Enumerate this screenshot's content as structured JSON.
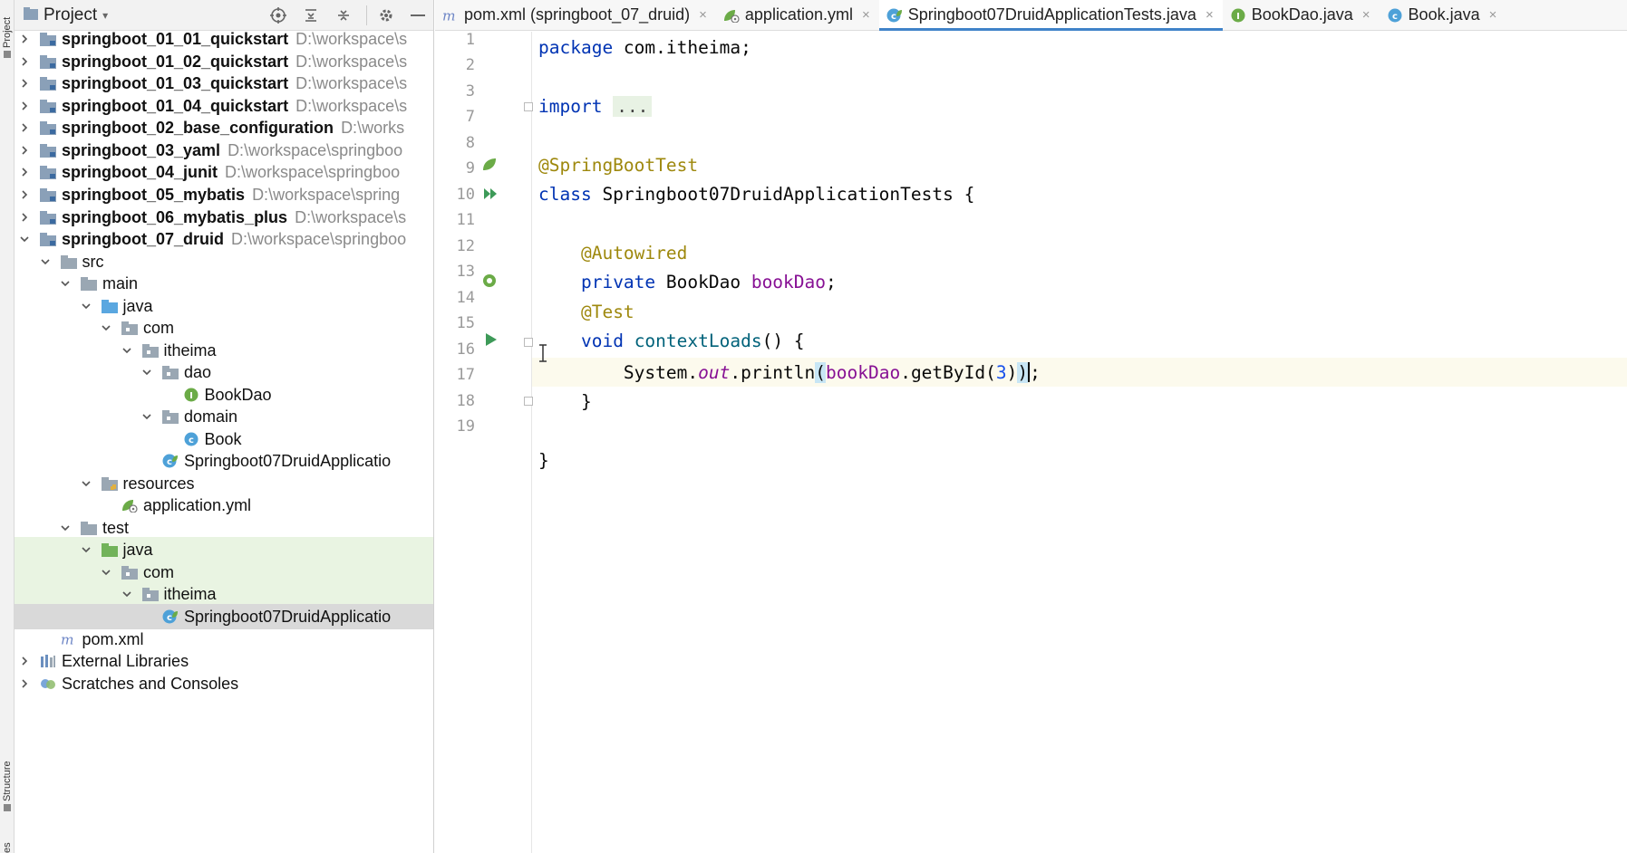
{
  "toolstrip": {
    "project_label": "Project",
    "structure_label": "Structure",
    "bottom_label": "es"
  },
  "project_panel": {
    "title": "Project",
    "header_icons": [
      "target-icon",
      "expand-all-icon",
      "collapse-all-icon",
      "gear-icon",
      "minimize-icon"
    ],
    "rows": [
      {
        "label": "springboot_01_01_quickstart",
        "path": "D:\\workspace\\s",
        "bold": true,
        "indent": 0,
        "chevron": "right",
        "icon": "module-folder-icon"
      },
      {
        "label": "springboot_01_02_quickstart",
        "path": "D:\\workspace\\s",
        "bold": true,
        "indent": 0,
        "chevron": "right",
        "icon": "module-folder-icon"
      },
      {
        "label": "springboot_01_03_quickstart",
        "path": "D:\\workspace\\s",
        "bold": true,
        "indent": 0,
        "chevron": "right",
        "icon": "module-folder-icon"
      },
      {
        "label": "springboot_01_04_quickstart",
        "path": "D:\\workspace\\s",
        "bold": true,
        "indent": 0,
        "chevron": "right",
        "icon": "module-folder-icon"
      },
      {
        "label": "springboot_02_base_configuration",
        "path": "D:\\works",
        "bold": true,
        "indent": 0,
        "chevron": "right",
        "icon": "module-folder-icon"
      },
      {
        "label": "springboot_03_yaml",
        "path": "D:\\workspace\\springboo",
        "bold": true,
        "indent": 0,
        "chevron": "right",
        "icon": "module-folder-icon"
      },
      {
        "label": "springboot_04_junit",
        "path": "D:\\workspace\\springboo",
        "bold": true,
        "indent": 0,
        "chevron": "right",
        "icon": "module-folder-icon"
      },
      {
        "label": "springboot_05_mybatis",
        "path": "D:\\workspace\\spring",
        "bold": true,
        "indent": 0,
        "chevron": "right",
        "icon": "module-folder-icon"
      },
      {
        "label": "springboot_06_mybatis_plus",
        "path": "D:\\workspace\\s",
        "bold": true,
        "indent": 0,
        "chevron": "right",
        "icon": "module-folder-icon"
      },
      {
        "label": "springboot_07_druid",
        "path": "D:\\workspace\\springboo",
        "bold": true,
        "indent": 0,
        "chevron": "down",
        "icon": "module-folder-icon"
      },
      {
        "label": "src",
        "path": "",
        "bold": false,
        "indent": 1,
        "chevron": "down",
        "icon": "folder-icon"
      },
      {
        "label": "main",
        "path": "",
        "bold": false,
        "indent": 2,
        "chevron": "down",
        "icon": "folder-icon"
      },
      {
        "label": "java",
        "path": "",
        "bold": false,
        "indent": 3,
        "chevron": "down",
        "icon": "source-folder-icon"
      },
      {
        "label": "com",
        "path": "",
        "bold": false,
        "indent": 4,
        "chevron": "down",
        "icon": "package-icon"
      },
      {
        "label": "itheima",
        "path": "",
        "bold": false,
        "indent": 5,
        "chevron": "down",
        "icon": "package-icon"
      },
      {
        "label": "dao",
        "path": "",
        "bold": false,
        "indent": 6,
        "chevron": "down",
        "icon": "package-icon"
      },
      {
        "label": "BookDao",
        "path": "",
        "bold": false,
        "indent": 7,
        "chevron": "none",
        "icon": "interface-icon"
      },
      {
        "label": "domain",
        "path": "",
        "bold": false,
        "indent": 6,
        "chevron": "down",
        "icon": "package-icon"
      },
      {
        "label": "Book",
        "path": "",
        "bold": false,
        "indent": 7,
        "chevron": "none",
        "icon": "class-icon"
      },
      {
        "label": "Springboot07DruidApplicatio",
        "path": "",
        "bold": false,
        "indent": 6,
        "chevron": "none",
        "icon": "spring-class-icon"
      },
      {
        "label": "resources",
        "path": "",
        "bold": false,
        "indent": 3,
        "chevron": "down",
        "icon": "resources-folder-icon"
      },
      {
        "label": "application.yml",
        "path": "",
        "bold": false,
        "indent": 4,
        "chevron": "none",
        "icon": "yml-file-icon"
      },
      {
        "label": "test",
        "path": "",
        "bold": false,
        "indent": 2,
        "chevron": "down",
        "icon": "folder-icon"
      },
      {
        "label": "java",
        "path": "",
        "bold": false,
        "indent": 3,
        "chevron": "down",
        "icon": "test-folder-icon",
        "highlight": "green"
      },
      {
        "label": "com",
        "path": "",
        "bold": false,
        "indent": 4,
        "chevron": "down",
        "icon": "package-icon",
        "highlight": "green"
      },
      {
        "label": "itheima",
        "path": "",
        "bold": false,
        "indent": 5,
        "chevron": "down",
        "icon": "package-icon",
        "highlight": "green"
      },
      {
        "label": "Springboot07DruidApplicatio",
        "path": "",
        "bold": false,
        "indent": 6,
        "chevron": "none",
        "icon": "spring-class-icon",
        "highlight": "selected"
      },
      {
        "label": "pom.xml",
        "path": "",
        "bold": false,
        "indent": 1,
        "chevron": "none",
        "icon": "maven-icon"
      },
      {
        "label": "External Libraries",
        "path": "",
        "bold": false,
        "indent": 0,
        "chevron": "right",
        "icon": "libraries-icon"
      },
      {
        "label": "Scratches and Consoles",
        "path": "",
        "bold": false,
        "indent": 0,
        "chevron": "right",
        "icon": "scratches-icon"
      }
    ]
  },
  "editor": {
    "tabs": [
      {
        "label": "pom.xml (springboot_07_druid)",
        "icon": "maven-icon",
        "active": false
      },
      {
        "label": "application.yml",
        "icon": "yml-file-icon",
        "active": false
      },
      {
        "label": "Springboot07DruidApplicationTests.java",
        "icon": "spring-class-icon",
        "active": true
      },
      {
        "label": "BookDao.java",
        "icon": "interface-icon",
        "active": false
      },
      {
        "label": "Book.java",
        "icon": "class-icon",
        "active": false
      }
    ],
    "line_numbers": [
      "1",
      "2",
      "3",
      "7",
      "8",
      "9",
      "10",
      "11",
      "12",
      "13",
      "14",
      "15",
      "16",
      "17",
      "18",
      "19"
    ],
    "code": {
      "l1_kw": "package",
      "l1_rest": " com.itheima;",
      "l3_kw": "import",
      "l3_fold": "...",
      "l8_ann": "@SpringBootTest",
      "l9_kw": "class",
      "l9_rest": " Springboot07DruidApplicationTests {",
      "l11_ann": "@Autowired",
      "l12_kw": "private",
      "l12_type": " BookDao ",
      "l12_field": "bookDao",
      "l12_end": ";",
      "l13_ann": "@Test",
      "l14_kw": "void",
      "l14_sp": " ",
      "l14_method": "contextLoads",
      "l14_end": "() {",
      "l15_a": "System.",
      "l15_out": "out",
      "l15_b": ".println",
      "l15_paren_open": "(",
      "l15_field": "bookDao",
      "l15_c": ".getById(",
      "l15_num": "3",
      "l15_d": ")",
      "l15_paren_close": ")",
      "l15_end": ";",
      "l16": "}",
      "l18": "}"
    }
  }
}
